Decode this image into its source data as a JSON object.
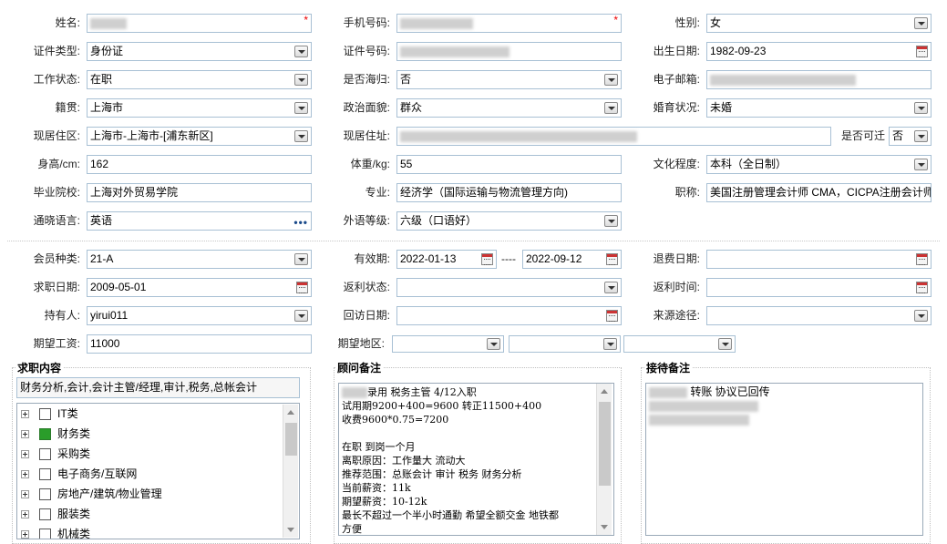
{
  "row1": {
    "name_label": "姓名:",
    "mobile_label": "手机号码:",
    "gender_label": "性别:",
    "gender_value": "女",
    "required_mark": "*"
  },
  "row2": {
    "id_type_label": "证件类型:",
    "id_type_value": "身份证",
    "id_no_label": "证件号码:",
    "birth_label": "出生日期:",
    "birth_value": "1982-09-23"
  },
  "row3": {
    "work_label": "工作状态:",
    "work_value": "在职",
    "overseas_label": "是否海归:",
    "overseas_value": "否",
    "email_label": "电子邮箱:"
  },
  "row4": {
    "native_label": "籍贯:",
    "native_value": "上海市",
    "political_label": "政治面貌:",
    "political_value": "群众",
    "marital_label": "婚育状况:",
    "marital_value": "未婚"
  },
  "row5": {
    "area_label": "现居住区:",
    "area_value": "上海市-上海市-[浦东新区]",
    "address_label": "现居住址:",
    "relocate_label": "是否可迁",
    "relocate_value": "否"
  },
  "row6": {
    "height_label": "身高/cm:",
    "height_value": "162",
    "weight_label": "体重/kg:",
    "weight_value": "55",
    "edu_label": "文化程度:",
    "edu_value": "本科（全日制）"
  },
  "row7": {
    "school_label": "毕业院校:",
    "school_value": "上海对外贸易学院",
    "major_label": "专业:",
    "major_value": "经济学（国际运输与物流管理方向)",
    "title_label": "职称:",
    "title_value": "美国注册管理会计师 CMA，CICPA注册会计师"
  },
  "row8": {
    "lang_label": "通晓语言:",
    "lang_value": "英语",
    "lang_more": "•••",
    "level_label": "外语等级:",
    "level_value": "六级（口语好）"
  },
  "row9": {
    "member_label": "会员种类:",
    "member_value": "21-A",
    "valid_label": "有效期:",
    "valid_from": "2022-01-13",
    "valid_sep": "----",
    "valid_to": "2022-09-12",
    "refund_label": "退费日期:"
  },
  "row10": {
    "seek_label": "求职日期:",
    "seek_value": "2009-05-01",
    "rebate_label": "返利状态:",
    "rebate_time_label": "返利时间:"
  },
  "row11": {
    "holder_label": "持有人:",
    "holder_value": "yirui011",
    "visit_label": "回访日期:",
    "source_label": "来源途径:"
  },
  "row12": {
    "salary_label": "期望工资:",
    "salary_value": "11000",
    "region_label": "期望地区:"
  },
  "job": {
    "title": "求职内容",
    "summary": "财务分析,会计,会计主管/经理,审计,税务,总帐会计",
    "categories": [
      {
        "label": "IT类",
        "checked": false
      },
      {
        "label": "财务类",
        "checked": true
      },
      {
        "label": "采购类",
        "checked": false
      },
      {
        "label": "电子商务/互联网",
        "checked": false
      },
      {
        "label": "房地产/建筑/物业管理",
        "checked": false
      },
      {
        "label": "服装类",
        "checked": false
      },
      {
        "label": "机械类",
        "checked": false
      }
    ]
  },
  "advisor": {
    "title": "顾问备注",
    "line1": "录用 税务主管 4/12入职",
    "rest": "试用期9200+400=9600 转正11500+400\n收费9600*0.75=7200\n\n在职 到岗一个月\n离职原因：工作量大 流动大\n推荐范围：总账会计 审计 税务 财务分析\n当前薪资：11k\n期望薪资：10-12k\n最长不超过一个半小时通勤 希望全额交金 地铁都\n方便"
  },
  "reception": {
    "title": "接待备注",
    "line1": "转账 协议已回传"
  }
}
